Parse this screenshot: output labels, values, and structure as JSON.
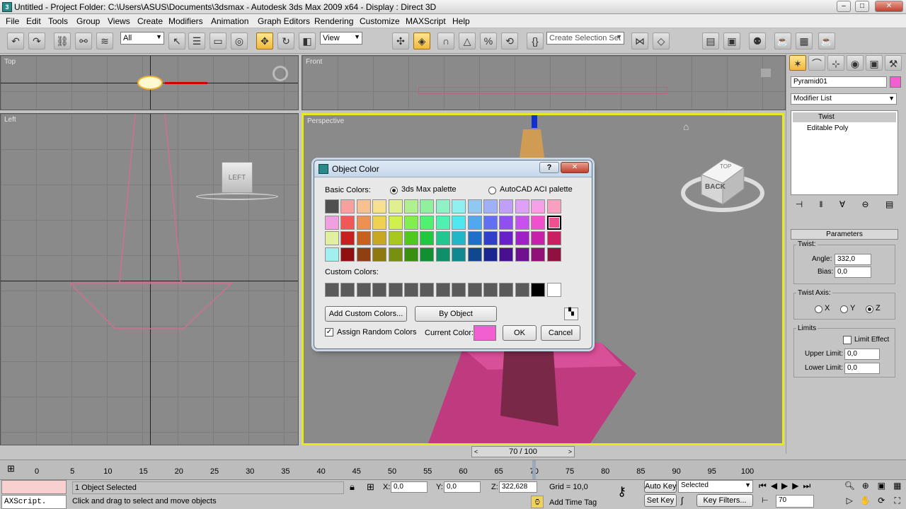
{
  "window": {
    "title": "Untitled      - Project Folder: C:\\Users\\ASUS\\Documents\\3dsmax     - Autodesk 3ds Max  2009 x64      - Display : Direct 3D",
    "min": "–",
    "max": "□",
    "close": "✕"
  },
  "menu": [
    "File",
    "Edit",
    "Tools",
    "Group",
    "Views",
    "Create",
    "Modifiers",
    "Animation",
    "Graph Editors",
    "Rendering",
    "Customize",
    "MAXScript",
    "Help"
  ],
  "toolbar": {
    "filter_value": "All",
    "refcoord_value": "View",
    "selection_set_placeholder": "Create Selection Set"
  },
  "viewports": {
    "top": "Top",
    "front": "Front",
    "left": "Left",
    "perspective": "Perspective",
    "left_cube_label": "LEFT",
    "viewcube_back": "BACK",
    "viewcube_top": "TOP"
  },
  "dialog": {
    "title": "Object Color",
    "help": "?",
    "close": "✕",
    "basic_colors_label": "Basic Colors:",
    "radio_3ds": "3ds Max palette",
    "radio_aci": "AutoCAD ACI palette",
    "custom_colors_label": "Custom Colors:",
    "add_custom": "Add Custom Colors...",
    "by_object": "By Object",
    "assign_random": "Assign Random Colors",
    "current_color_label": "Current Color:",
    "current_color": "#f25fd0",
    "ok": "OK",
    "cancel": "Cancel",
    "basic_colors": [
      [
        "#505050",
        "#f7a0a0",
        "#f7c090",
        "#f7e090",
        "#e0f090",
        "#b0f090",
        "#90f0a0",
        "#90f0c8",
        "#90f0f0",
        "#90c8f0",
        "#a0b0f7",
        "#c0a0f7",
        "#e0a0f7",
        "#f7a0e8",
        "#f7a0c0"
      ],
      [
        "#f0a0e0",
        "#f05858",
        "#f09050",
        "#f0d050",
        "#d0f050",
        "#80f050",
        "#50f070",
        "#50f0b0",
        "#50e8f0",
        "#50a8f0",
        "#6070f0",
        "#9050f0",
        "#c850f0",
        "#f050d0",
        "#f05090"
      ],
      [
        "#e0f0a0",
        "#c82020",
        "#c86020",
        "#c8a820",
        "#a8c820",
        "#50c820",
        "#20c840",
        "#20c890",
        "#20b8c8",
        "#2070c8",
        "#3040c8",
        "#6820c8",
        "#a020c8",
        "#c820a8",
        "#c82060"
      ],
      [
        "#a0f0f0",
        "#901010",
        "#904010",
        "#907810",
        "#789010",
        "#389010",
        "#109030",
        "#109068",
        "#108890",
        "#104890",
        "#182890",
        "#481090",
        "#701090",
        "#901078",
        "#901040"
      ]
    ],
    "selected_swatch": "1-14",
    "custom_colors": [
      "#5a5a5a",
      "#5a5a5a",
      "#5a5a5a",
      "#5a5a5a",
      "#5a5a5a",
      "#5a5a5a",
      "#5a5a5a",
      "#5a5a5a",
      "#5a5a5a",
      "#5a5a5a",
      "#5a5a5a",
      "#5a5a5a",
      "#5a5a5a",
      "#000000",
      "#ffffff"
    ]
  },
  "command_panel": {
    "object_name": "Pyramid01",
    "object_color": "#f25fd0",
    "modifier_list": "Modifier List",
    "stack": [
      "Twist",
      "Editable Poly"
    ],
    "rollout": "Parameters",
    "twist_group": "Twist:",
    "angle_label": "Angle:",
    "angle_value": "332,0",
    "bias_label": "Bias:",
    "bias_value": "0,0",
    "axis_group": "Twist Axis:",
    "axis_x": "X",
    "axis_y": "Y",
    "axis_z": "Z",
    "limits_group": "Limits",
    "limit_effect": "Limit Effect",
    "upper_label": "Upper Limit:",
    "upper_value": "0,0",
    "lower_label": "Lower Limit:",
    "lower_value": "0,0"
  },
  "timeline": {
    "frame_display": "70 / 100",
    "ticks": [
      "0",
      "5",
      "10",
      "15",
      "20",
      "25",
      "30",
      "35",
      "40",
      "45",
      "50",
      "55",
      "60",
      "65",
      "70",
      "75",
      "80",
      "85",
      "90",
      "95",
      "100"
    ]
  },
  "status": {
    "maxscript": "AXScript.",
    "selected": "1 Object Selected",
    "prompt": "Click and drag to select and move objects",
    "x_label": "X:",
    "x_value": "0,0",
    "y_label": "Y:",
    "y_value": "0,0",
    "z_label": "Z:",
    "z_value": "322,628",
    "grid": "Grid = 10,0",
    "add_time_tag": "Add Time Tag",
    "auto_key": "Auto Key",
    "set_key": "Set Key",
    "key_mode": "Selected",
    "key_filters": "Key Filters...",
    "frame": "70"
  }
}
